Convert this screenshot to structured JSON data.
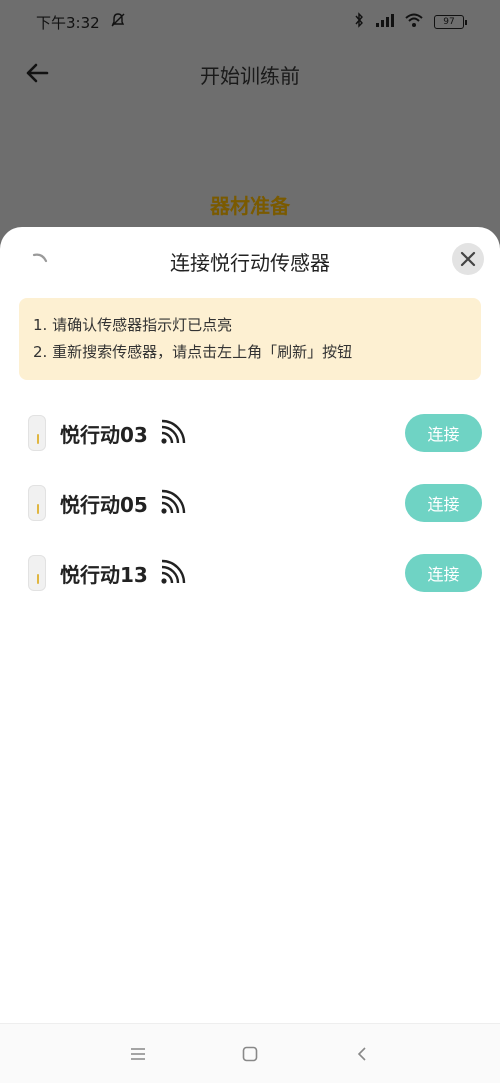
{
  "status_bar": {
    "time": "下午3:32",
    "battery": "97"
  },
  "header": {
    "title": "开始训练前"
  },
  "section": {
    "title": "器材准备"
  },
  "sheet": {
    "title": "连接悦行动传感器",
    "notice": {
      "line1": "1. 请确认传感器指示灯已点亮",
      "line2": "2. 重新搜索传感器，请点击左上角「刷新」按钮"
    },
    "devices": [
      {
        "name": "悦行动03",
        "button": "连接"
      },
      {
        "name": "悦行动05",
        "button": "连接"
      },
      {
        "name": "悦行动13",
        "button": "连接"
      }
    ]
  },
  "colors": {
    "accent": "#6fd3c4",
    "notice_bg": "#fdf0d2",
    "section_title": "#7a5a00",
    "overlay": "#6e6e6e"
  },
  "icons": [
    "bell-off-icon",
    "bluetooth-icon",
    "cell-signal-icon",
    "wifi-icon",
    "battery-icon",
    "back-arrow-icon",
    "refresh-spinner-icon",
    "close-icon",
    "sensor-device-icon",
    "signal-strength-icon",
    "menu-icon",
    "home-icon",
    "back-icon"
  ]
}
